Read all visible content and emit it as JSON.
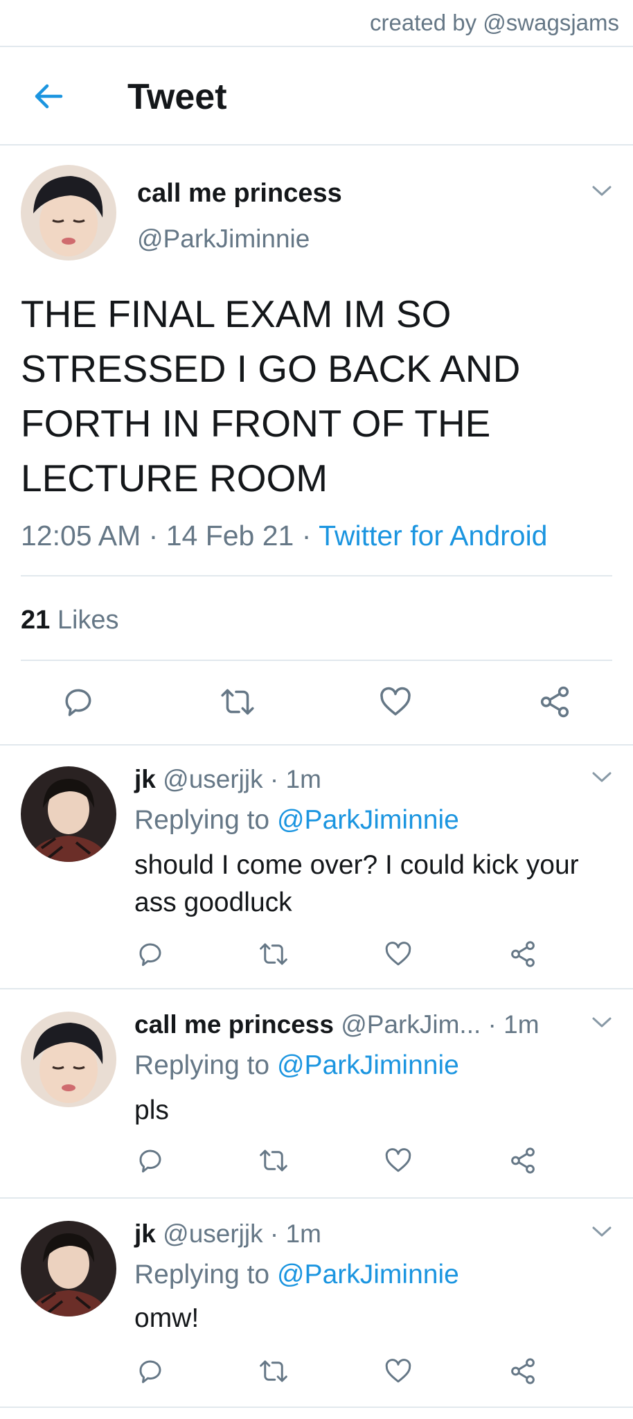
{
  "watermark": "created by @swagsjams",
  "header": {
    "title": "Tweet"
  },
  "main_tweet": {
    "display_name": "call me princess",
    "handle": "@ParkJiminnie",
    "text_lines": [
      "THE FINAL EXAM IM SO",
      "STRESSED I GO BACK AND",
      "FORTH IN FRONT OF THE",
      "LECTURE ROOM"
    ],
    "time": "12:05 AM",
    "date": "14 Feb 21",
    "separator": "·",
    "source": "Twitter for Android",
    "likes_count": "21",
    "likes_label": "Likes"
  },
  "replies": [
    {
      "display_name": "jk",
      "handle": "@userjjk",
      "time": "· 1m",
      "replying_prefix": "Replying to",
      "replying_to": "@ParkJiminnie",
      "text_lines": [
        "should I come over? I could kick your",
        "ass goodluck"
      ]
    },
    {
      "display_name": "call me princess",
      "handle": "@ParkJim...",
      "time": "· 1m",
      "replying_prefix": "Replying to",
      "replying_to": "@ParkJiminnie",
      "text_lines": [
        "pls"
      ]
    },
    {
      "display_name": "jk",
      "handle": "@userjjk",
      "time": "· 1m",
      "replying_prefix": "Replying to",
      "replying_to": "@ParkJiminnie",
      "text_lines": [
        "omw!"
      ]
    }
  ],
  "icons": [
    "back-arrow-icon",
    "chevron-down-icon",
    "reply-icon",
    "retweet-icon",
    "like-icon",
    "share-icon"
  ],
  "colors": {
    "accent": "#1b95e0",
    "text": "#14171a",
    "muted": "#657786",
    "divider": "#e1e8ed"
  }
}
